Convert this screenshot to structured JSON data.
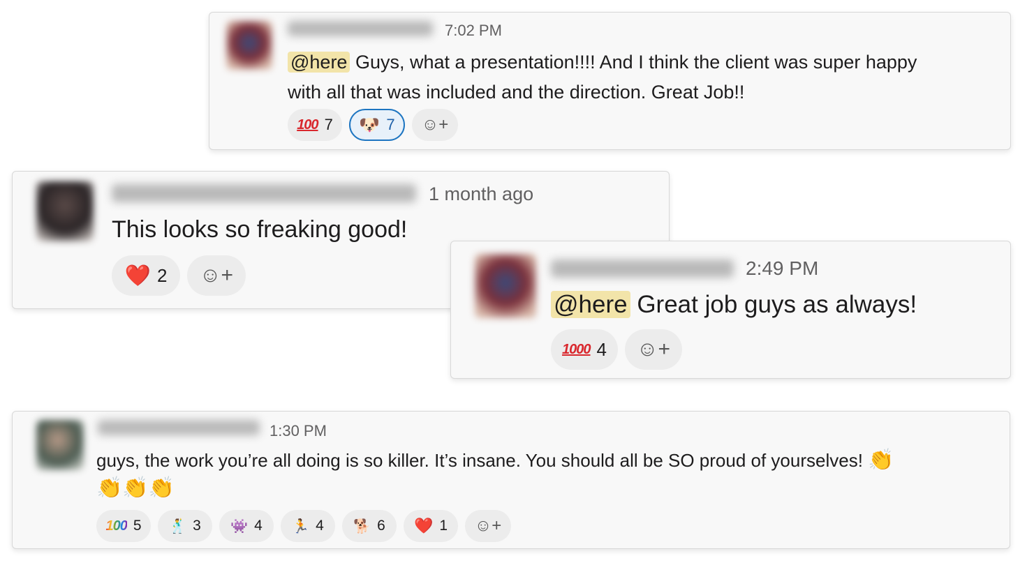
{
  "msg1": {
    "time": "7:02 PM",
    "mention": "@here",
    "line1": " Guys, what a presentation!!!! And I think the client was super happy",
    "line2": "with all that was included and the direction. Great Job!!",
    "reactions": [
      {
        "emoji": "💯",
        "icon": "hundred-points-icon",
        "count": "7"
      },
      {
        "emoji": "🐶",
        "icon": "corgi-dog-icon",
        "count": "7",
        "active": true
      }
    ]
  },
  "msg2": {
    "time": "1 month ago",
    "text": "This looks so freaking good!",
    "reactions": [
      {
        "emoji": "❤️",
        "icon": "red-heart-icon",
        "count": "2"
      }
    ]
  },
  "msg3": {
    "time": "2:49 PM",
    "mention": "@here",
    "text": " Great job guys as always!",
    "reactions": [
      {
        "emoji": "1000",
        "icon": "thousand-points-icon",
        "count": "4"
      }
    ]
  },
  "msg4": {
    "time": "1:30 PM",
    "line1": "guys, the work you’re all doing is so killer. It’s insane. You should all be SO proud of yourselves!",
    "clap": "👏",
    "clap_line": "👏👏👏",
    "reactions": [
      {
        "emoji": "💯",
        "icon": "rainbow-hundred-icon",
        "count": "5"
      },
      {
        "emoji": "🕺",
        "icon": "dancing-person-icon",
        "count": "3"
      },
      {
        "emoji": "👾",
        "icon": "green-blob-icon",
        "count": "4"
      },
      {
        "emoji": "🏃",
        "icon": "running-figure-icon",
        "count": "4"
      },
      {
        "emoji": "🐕",
        "icon": "cool-doge-icon",
        "count": "6"
      },
      {
        "emoji": "❤️",
        "icon": "red-heart-icon",
        "count": "1"
      }
    ]
  },
  "add_reaction_icon": "☺+"
}
